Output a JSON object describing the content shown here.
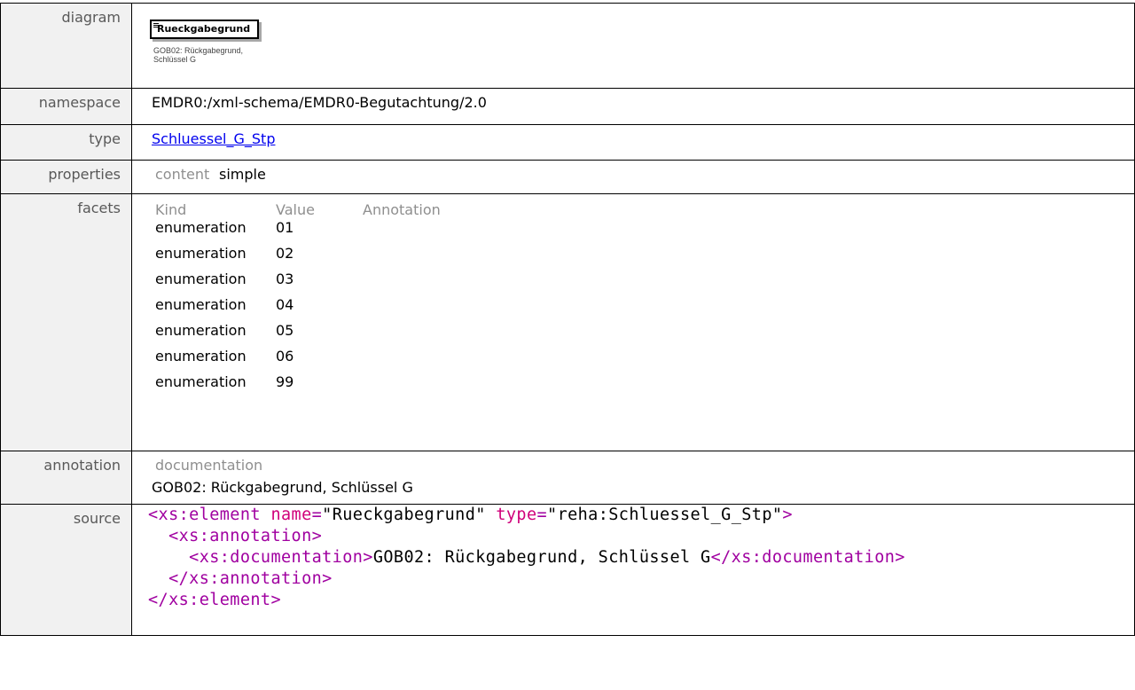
{
  "rows": {
    "diagram": {
      "label": "diagram",
      "element_name": "Rueckgabegrund",
      "doc_line1": "GOB02: Rückgabegrund,",
      "doc_line2": "Schlüssel G"
    },
    "namespace": {
      "label": "namespace",
      "value": "EMDR0:/xml-schema/EMDR0-Begutachtung/2.0"
    },
    "type": {
      "label": "type",
      "value": "Schluessel_G_Stp"
    },
    "properties": {
      "label": "properties",
      "key": "content",
      "value": "simple"
    },
    "facets": {
      "label": "facets",
      "headers": [
        "Kind",
        "Value",
        "Annotation"
      ],
      "items": [
        {
          "kind": "enumeration",
          "value": "01"
        },
        {
          "kind": "enumeration",
          "value": "02"
        },
        {
          "kind": "enumeration",
          "value": "03"
        },
        {
          "kind": "enumeration",
          "value": "04"
        },
        {
          "kind": "enumeration",
          "value": "05"
        },
        {
          "kind": "enumeration",
          "value": "06"
        },
        {
          "kind": "enumeration",
          "value": "99"
        }
      ]
    },
    "annotation": {
      "label": "annotation",
      "title": "documentation",
      "text": "GOB02: Rückgabegrund, Schlüssel G"
    },
    "source": {
      "label": "source",
      "line1_open": "<xs:element",
      "line1_attr1": "name",
      "line1_val1": "\"Rueckgabegrund\"",
      "line1_attr2": "type",
      "line1_val2": "\"reha:Schluessel_G_Stp\"",
      "line1_close": ">",
      "line2": "<xs:annotation>",
      "line3_open": "<xs:documentation>",
      "line3_text": "GOB02: Rückgabegrund, Schlüssel G",
      "line3_close": "</xs:documentation>",
      "line4": "</xs:annotation>",
      "line5": "</xs:element>"
    }
  },
  "colors": {
    "label_bg": "#f1f1f1",
    "label_text": "#595959",
    "muted_text": "#8f8f8f",
    "link": "#0000ee",
    "xml_tag": "#a000a0",
    "xml_attr": "#d0007a"
  }
}
